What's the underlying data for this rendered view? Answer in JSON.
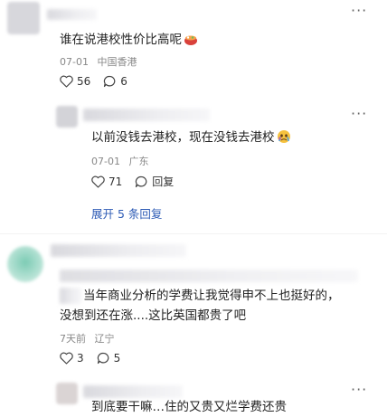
{
  "comments": [
    {
      "text": "谁在说港校性价比高呢",
      "emoji": "hot-pot-icon",
      "date": "07-01",
      "location": "中国香港",
      "likes": "56",
      "replies": "6"
    },
    {
      "text": "以前没钱去港校，现在没钱去港校",
      "emoji": "crying-face-icon",
      "date": "07-01",
      "location": "广东",
      "likes": "71",
      "reply_label": "回复",
      "expand_label": "展开 5 条回复"
    },
    {
      "text_line1": "当年商业分析的学费让我觉得申不上也挺好的，",
      "text_line2": "没想到还在涨....这比英国都贵了吧",
      "date": "7天前",
      "location": "辽宁",
      "likes": "3",
      "replies": "5"
    },
    {
      "text": "到底要干嘛…住的又贵又烂学费还贵"
    }
  ],
  "more_label": "···",
  "colors": {
    "link": "#2d5bb5",
    "meta": "#888888",
    "avatar_green": "#7ccbb4"
  }
}
